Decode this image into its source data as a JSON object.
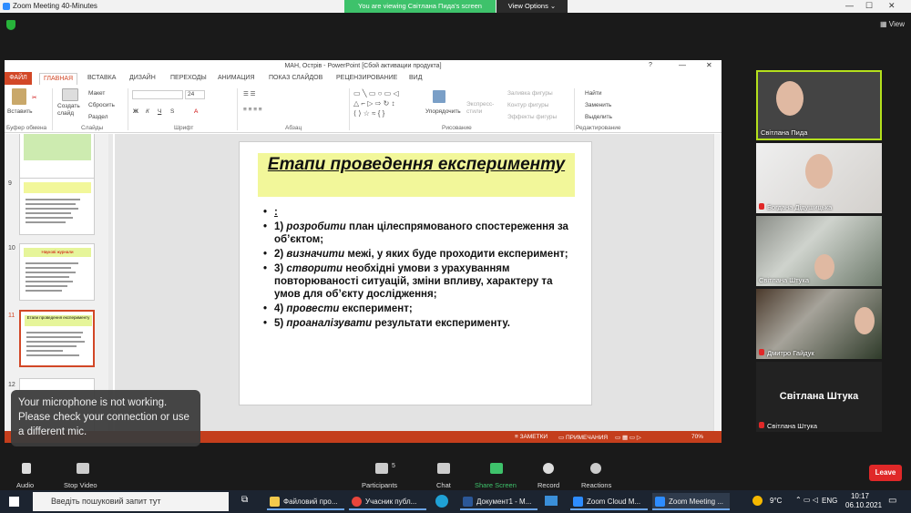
{
  "zoom": {
    "window_title": "Zoom Meeting 40-Minutes",
    "viewing_banner": "You are viewing Світлана Пида's screen",
    "view_options": "View Options ⌄",
    "view_label": "View",
    "mic_warning": "Your microphone is not working. Please check your connection or use a different mic.",
    "toolbar": {
      "audio": "Audio",
      "stop_video": "Stop Video",
      "participants": "Participants",
      "participants_count": "5",
      "chat": "Chat",
      "share_screen": "Share Screen",
      "record": "Record",
      "reactions": "Reactions",
      "leave": "Leave"
    },
    "participants": [
      {
        "name": "Світлана Пида"
      },
      {
        "name": "Богдана Дідушицька"
      },
      {
        "name": "Світлана Штука"
      },
      {
        "name": "Дмитро Гайдук"
      },
      {
        "name": "Світлана Штука",
        "big": "Світлана Штука"
      }
    ]
  },
  "ppt": {
    "window_title": "МАН, Острів - PowerPoint [Сбой активации продукта]",
    "tabs": [
      "ФАЙЛ",
      "ГЛАВНАЯ",
      "ВСТАВКА",
      "ДИЗАЙН",
      "ПЕРЕХОДЫ",
      "АНИМАЦИЯ",
      "ПОКАЗ СЛАЙДОВ",
      "РЕЦЕНЗИРОВАНИЕ",
      "ВИД"
    ],
    "ribbon": {
      "paste": "Вставить",
      "create_slide": "Создать слайд",
      "layout": "Макет",
      "reset": "Сбросить",
      "section": "Раздел",
      "font_size": "24",
      "arrange": "Упорядочить",
      "express_styles": "Экспресс-стили",
      "fill": "Заливка фигуры",
      "outline": "Контур фигуры",
      "effects": "Эффекты фигуры",
      "find": "Найти",
      "replace": "Заменить",
      "select": "Выделить",
      "groups": [
        "Буфер обмена",
        "Слайды",
        "Шрифт",
        "Абзац",
        "Рисование",
        "Редактирование"
      ]
    },
    "thumbnail_numbers": [
      "9",
      "10",
      "11",
      "12"
    ],
    "thumb10_title": "Наукові журнали",
    "thumb11_title": "Етапи проведення експерименту",
    "slide": {
      "title": "Етапи проведення експерименту",
      "bullets": [
        {
          "em": "",
          "text": ":"
        },
        {
          "num": "1) ",
          "em": "розробити",
          "text": " план цілеспрямованого спостереження за об’єктом;"
        },
        {
          "num": "2) ",
          "em": "визначити",
          "text": " межі, у яких буде проходити експеримент;"
        },
        {
          "num": "3) ",
          "em": "створити",
          "text": " необхідні умови з урахуванням повторюваності ситуацій, зміни впливу, характеру та умов для об’єкту дослідження;"
        },
        {
          "num": "4) ",
          "em": "провести",
          "text": " експеримент;"
        },
        {
          "num": "5) ",
          "em": "проаналізувати",
          "text": " результати експерименту."
        }
      ]
    },
    "status": {
      "notes": "ЗАМЕТКИ",
      "comments": "ПРИМЕЧАНИЯ",
      "zoom": "70%"
    }
  },
  "taskbar": {
    "search_placeholder": "Введіть пошуковий запит тут",
    "items": [
      "Файловий про...",
      "Учасник публ...",
      "Документ1 - М...",
      "Zoom Cloud M...",
      "Zoom Meeting ..."
    ],
    "weather": "9°C",
    "lang": "ENG",
    "time": "10:17",
    "date": "06.10.2021"
  }
}
